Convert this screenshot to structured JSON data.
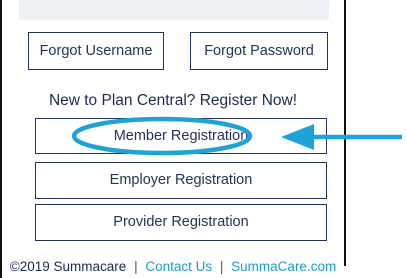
{
  "forgot": {
    "username_label": "Forgot Username",
    "password_label": "Forgot  Password"
  },
  "register": {
    "heading": "New to Plan Central? Register Now!",
    "member_label": "Member Registration",
    "employer_label": "Employer Registration",
    "provider_label": "Provider Registration"
  },
  "footer": {
    "copyright": "©2019 Summacare",
    "separator": "|",
    "contact_label": "Contact Us",
    "site_label": "SummaCare.com"
  },
  "annotation": {
    "color": "#1fa3d6",
    "icons": [
      "highlight-ellipse",
      "pointer-arrow"
    ]
  }
}
